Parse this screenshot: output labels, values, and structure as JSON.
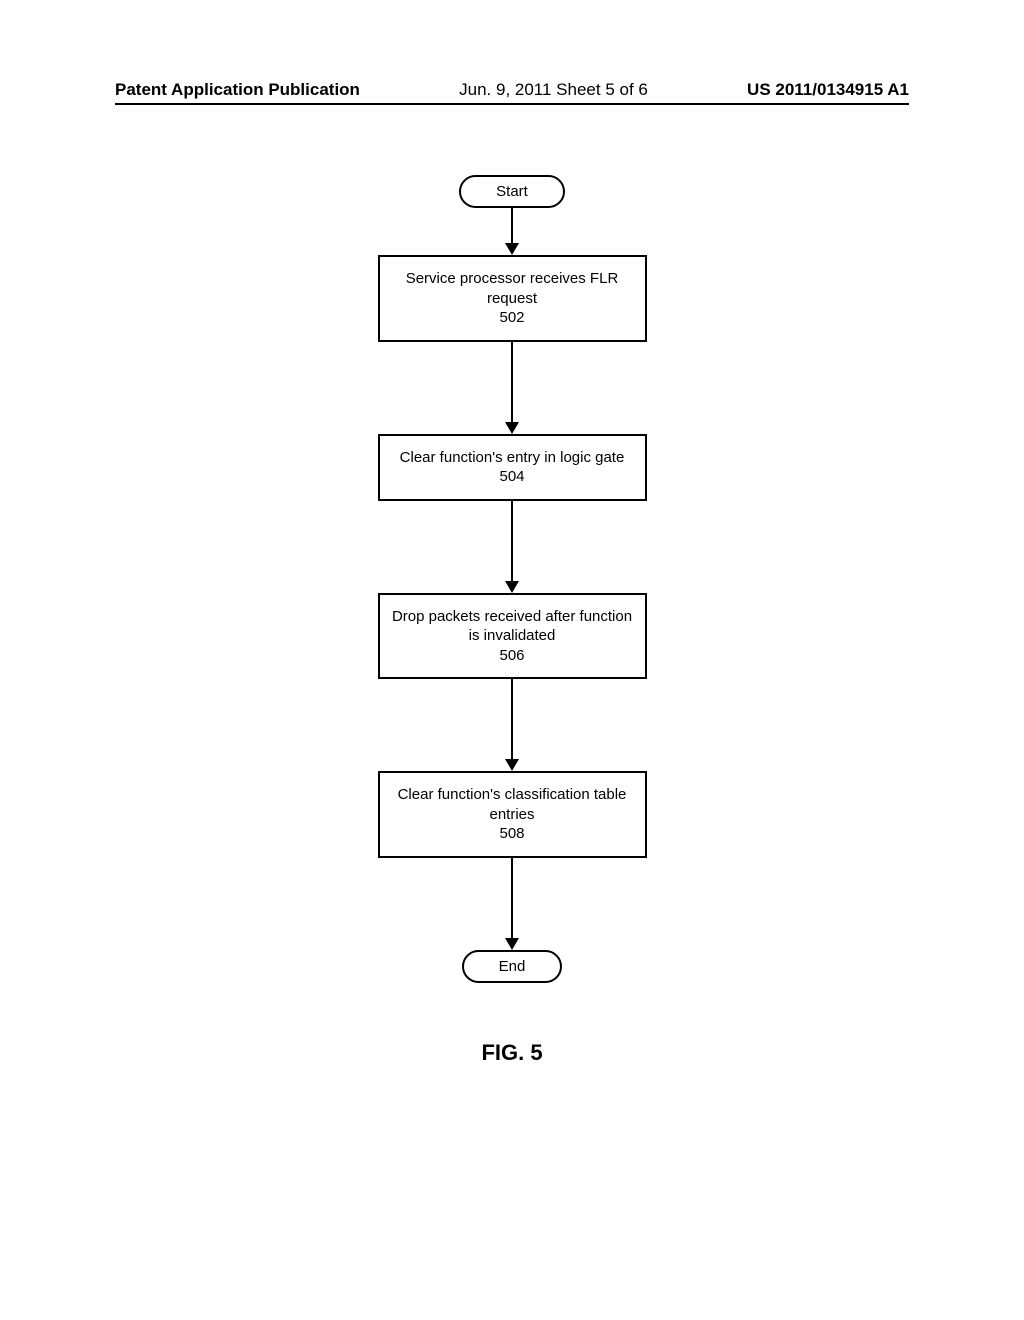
{
  "header": {
    "left": "Patent Application Publication",
    "center": "Jun. 9, 2011  Sheet 5 of 6",
    "right": "US 2011/0134915 A1"
  },
  "flowchart": {
    "start": "Start",
    "step1": {
      "text": "Service processor receives FLR request",
      "number": "502"
    },
    "step2": {
      "text": "Clear function's entry in logic gate",
      "number": "504"
    },
    "step3": {
      "text": "Drop packets received after function is invalidated",
      "number": "506"
    },
    "step4": {
      "text": "Clear function's classification table entries",
      "number": "508"
    },
    "end": "End"
  },
  "figureLabel": "FIG. 5"
}
